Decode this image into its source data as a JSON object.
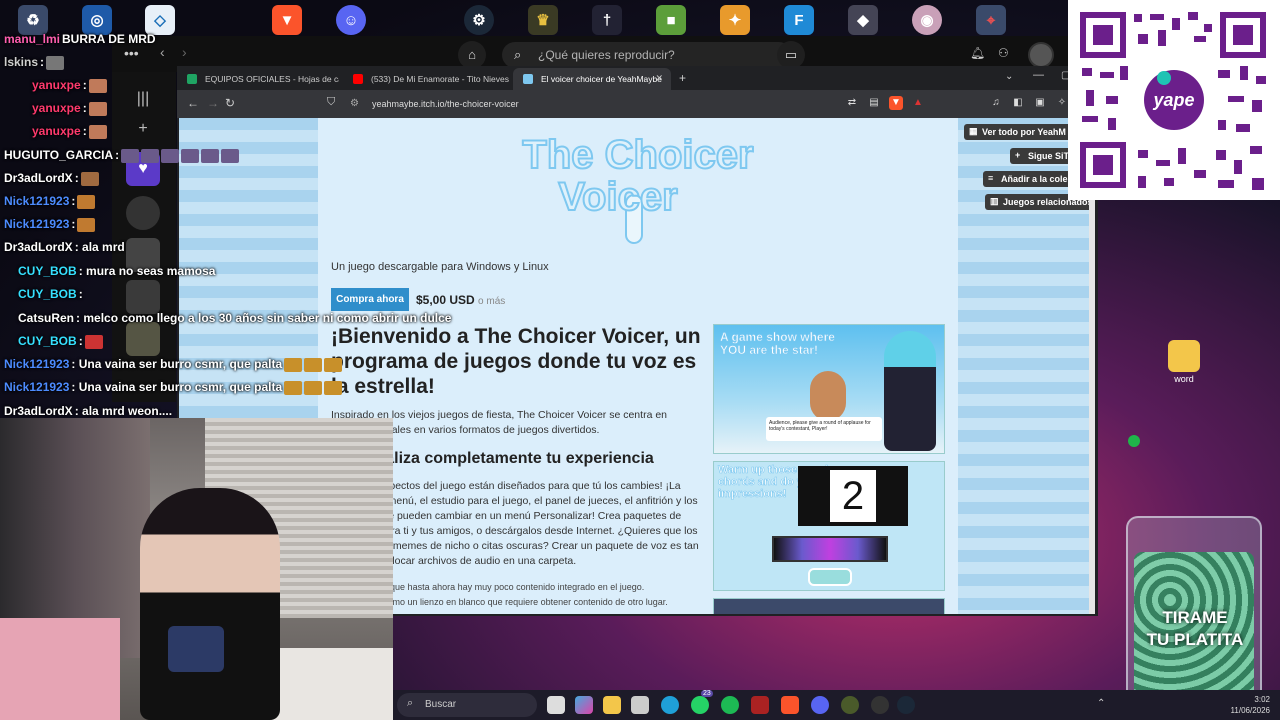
{
  "desktop": {
    "word_icon_label": "word"
  },
  "spotify": {
    "search_placeholder": "¿Qué quieres reproducir?"
  },
  "browser": {
    "tabs": [
      {
        "label": "EQUIPOS OFICIALES - Hojas de cálcu"
      },
      {
        "label": "(533) De Mi Enamorate - Tito Nieves"
      },
      {
        "label": "El voicer choicer de YeahMaybe"
      }
    ],
    "url": "yeahmaybe.itch.io/the-choicer-voicer"
  },
  "page": {
    "logo_line1": "The Choicer",
    "logo_line2": "Voicer",
    "subtitle": "Un juego descargable para Windows y Linux",
    "buy_label": "Compra ahora",
    "price": "$5,00 USD",
    "price_more": "o más",
    "heading": "¡Bienvenido a The Choicer Voicer, un programa de juegos donde tu voz es la estrella!",
    "intro": "Inspirado en los viejos juegos de fiesta, The Choicer Voicer se centra en sesiones vocales en varios formatos de juegos divertidos.",
    "heading2": "Personaliza completamente tu experiencia",
    "custom_text": "Todos los aspectos del juego están diseñados para que tú los cambies! ¡La pantalla del menú, el estudio para el juego, el panel de jueces, el anfitrión y los jugadores, se pueden cambiar en un menú Personalizar! Crea paquetes de contenido para ti y tus amigos, o descárgalos desde Internet. ¿Quieres que los jueces digan memes de nicho o citas oscuras? Crear un paquete de voz es tan fácil como colocar archivos de audio en una carpeta.",
    "note1": "Ten en cuenta que hasta ahora hay muy poco contenido integrado en el juego.",
    "note2": "Piensa en él como un lienzo en blanco que requiere obtener contenido de otro lugar.",
    "shot1_caption": "A game show where YOU are the star!",
    "shot1_dialog": "Audience, please give a round of applause for today's contestant, Player!",
    "shot2_caption": "Warm up those vocal chords and do your best impressions!",
    "shot2_number": "2",
    "side_buttons": [
      {
        "label": "Ver todo por YeahM"
      },
      {
        "label": "Sigue SiT"
      },
      {
        "label": "Añadir a la cole"
      },
      {
        "label": "Juegos relacionados"
      }
    ]
  },
  "chat": [
    {
      "user": "manu_lmi",
      "text": "BURRA DE MRD",
      "color": "#ff5fb0"
    },
    {
      "user": "lskins",
      "text": ":",
      "color": "#cfcfcf"
    },
    {
      "user": "yanuxpe",
      "text": ":",
      "color": "#ff3a6e"
    },
    {
      "user": "yanuxpe",
      "text": ":",
      "color": "#ff3a6e"
    },
    {
      "user": "yanuxpe",
      "text": ":",
      "color": "#ff3a6e"
    },
    {
      "user": "HUGUITO_GARCIA",
      "text": ":",
      "color": "#ffffff"
    },
    {
      "user": "Dr3adLordX",
      "text": ":",
      "color": "#ffffff"
    },
    {
      "user": "Nick121923",
      "text": ":",
      "color": "#4d8cff"
    },
    {
      "user": "Nick121923",
      "text": ":",
      "color": "#4d8cff"
    },
    {
      "user": "Dr3adLordX",
      "text": ": ala mrd",
      "color": "#ffffff"
    },
    {
      "user": "CUY_BOB",
      "text": ": mura no seas mamosa",
      "color": "#36e0ff"
    },
    {
      "user": "CUY_BOB",
      "text": ":",
      "color": "#36e0ff"
    },
    {
      "user": "CatsuRen",
      "text": ": melco como llego a los 30 años sin saber ni como abrir un dulce",
      "color": "#ffffff"
    },
    {
      "user": "CUY_BOB",
      "text": ":",
      "color": "#36e0ff"
    },
    {
      "user": "Nick121923",
      "text": ": Una vaina ser burro csmr, que palta",
      "color": "#4d8cff"
    },
    {
      "user": "Nick121923",
      "text": ": Una vaina ser burro csmr, que palta",
      "color": "#4d8cff"
    },
    {
      "user": "Dr3adLordX",
      "text": ": ala mrd weon....",
      "color": "#ffffff"
    }
  ],
  "jar": {
    "line1": "TIRAME",
    "line2": "TU PLATITA"
  },
  "qr": {
    "brand": "yape"
  },
  "taskbar": {
    "search_placeholder": "Buscar",
    "badge_whatsapp": "23",
    "time": "3:02",
    "date": "11/06/2026"
  },
  "colors": {
    "accent": "#2f8ecb",
    "page_stripe_a": "#a9d3ee",
    "page_stripe_b": "#c6e3f5",
    "column_bg": "#dbeefb",
    "yape_purple": "#6b1f8b"
  }
}
